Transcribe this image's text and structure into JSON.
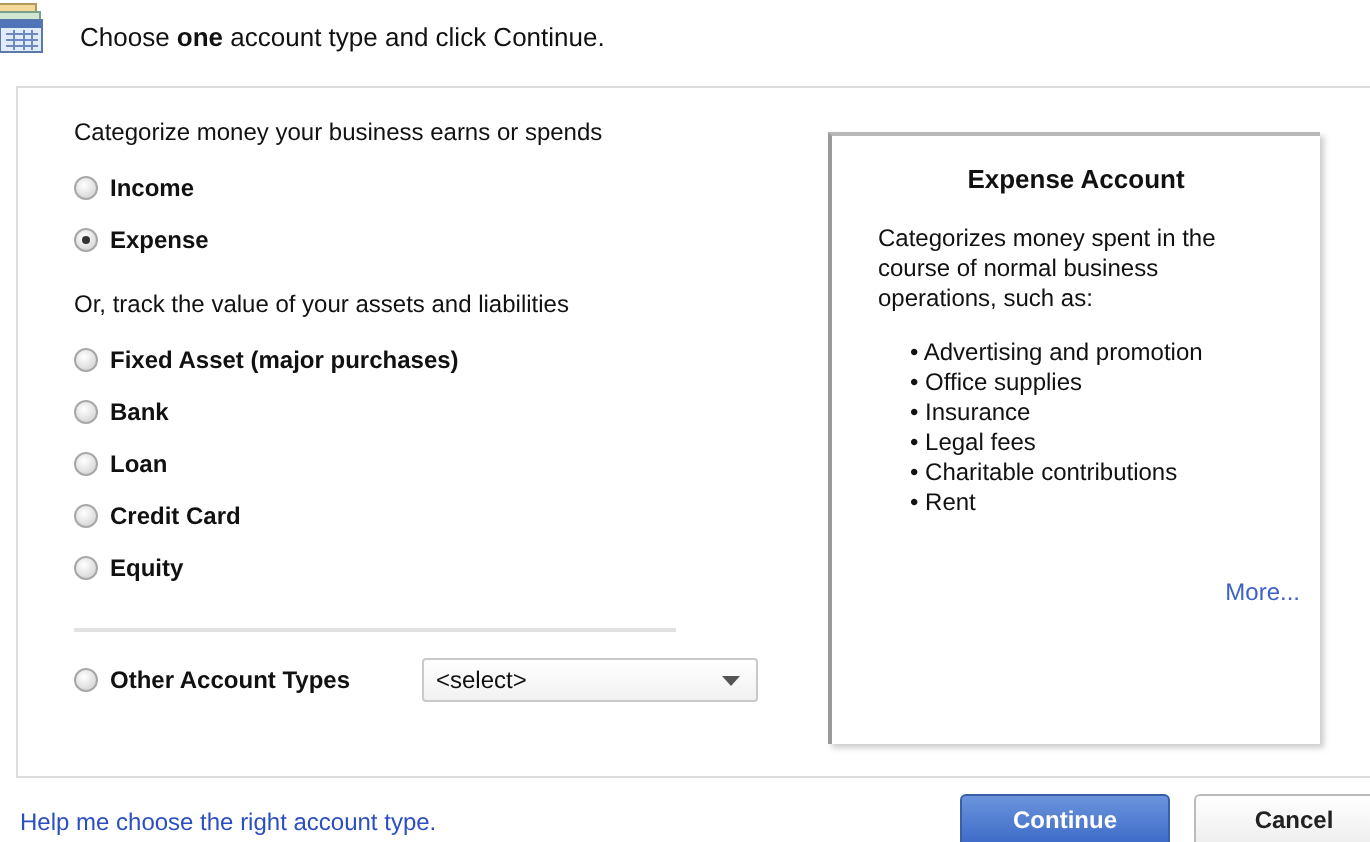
{
  "header": {
    "instruction": "Choose **one** account type and click Continue."
  },
  "groups": [
    {
      "heading": "Categorize money your business earns or spends",
      "options": [
        {
          "label": "Income",
          "selected": false
        },
        {
          "label": "Expense",
          "selected": true
        }
      ]
    },
    {
      "heading": "Or, track the value of your assets and liabilities",
      "options": [
        {
          "label": "Fixed Asset (major purchases)",
          "selected": false
        },
        {
          "label": "Bank",
          "selected": false
        },
        {
          "label": "Loan",
          "selected": false
        },
        {
          "label": "Credit Card",
          "selected": false
        },
        {
          "label": "Equity",
          "selected": false
        }
      ]
    }
  ],
  "other": {
    "label": "Other Account Types",
    "selected": false,
    "dropdown": "<select>"
  },
  "info": {
    "title": "Expense Account",
    "description": "Categorizes money spent in the course of normal business operations, such as:",
    "examples": [
      "• Advertising and promotion",
      "• Office supplies",
      "• Insurance",
      "• Legal fees",
      "• Charitable contributions",
      "• Rent"
    ],
    "more_link": "More..."
  },
  "help_link": "Help me choose the right account type.",
  "buttons": [
    {
      "label": "Continue",
      "kind": "primary"
    },
    {
      "label": "Cancel",
      "kind": "secondary"
    }
  ]
}
